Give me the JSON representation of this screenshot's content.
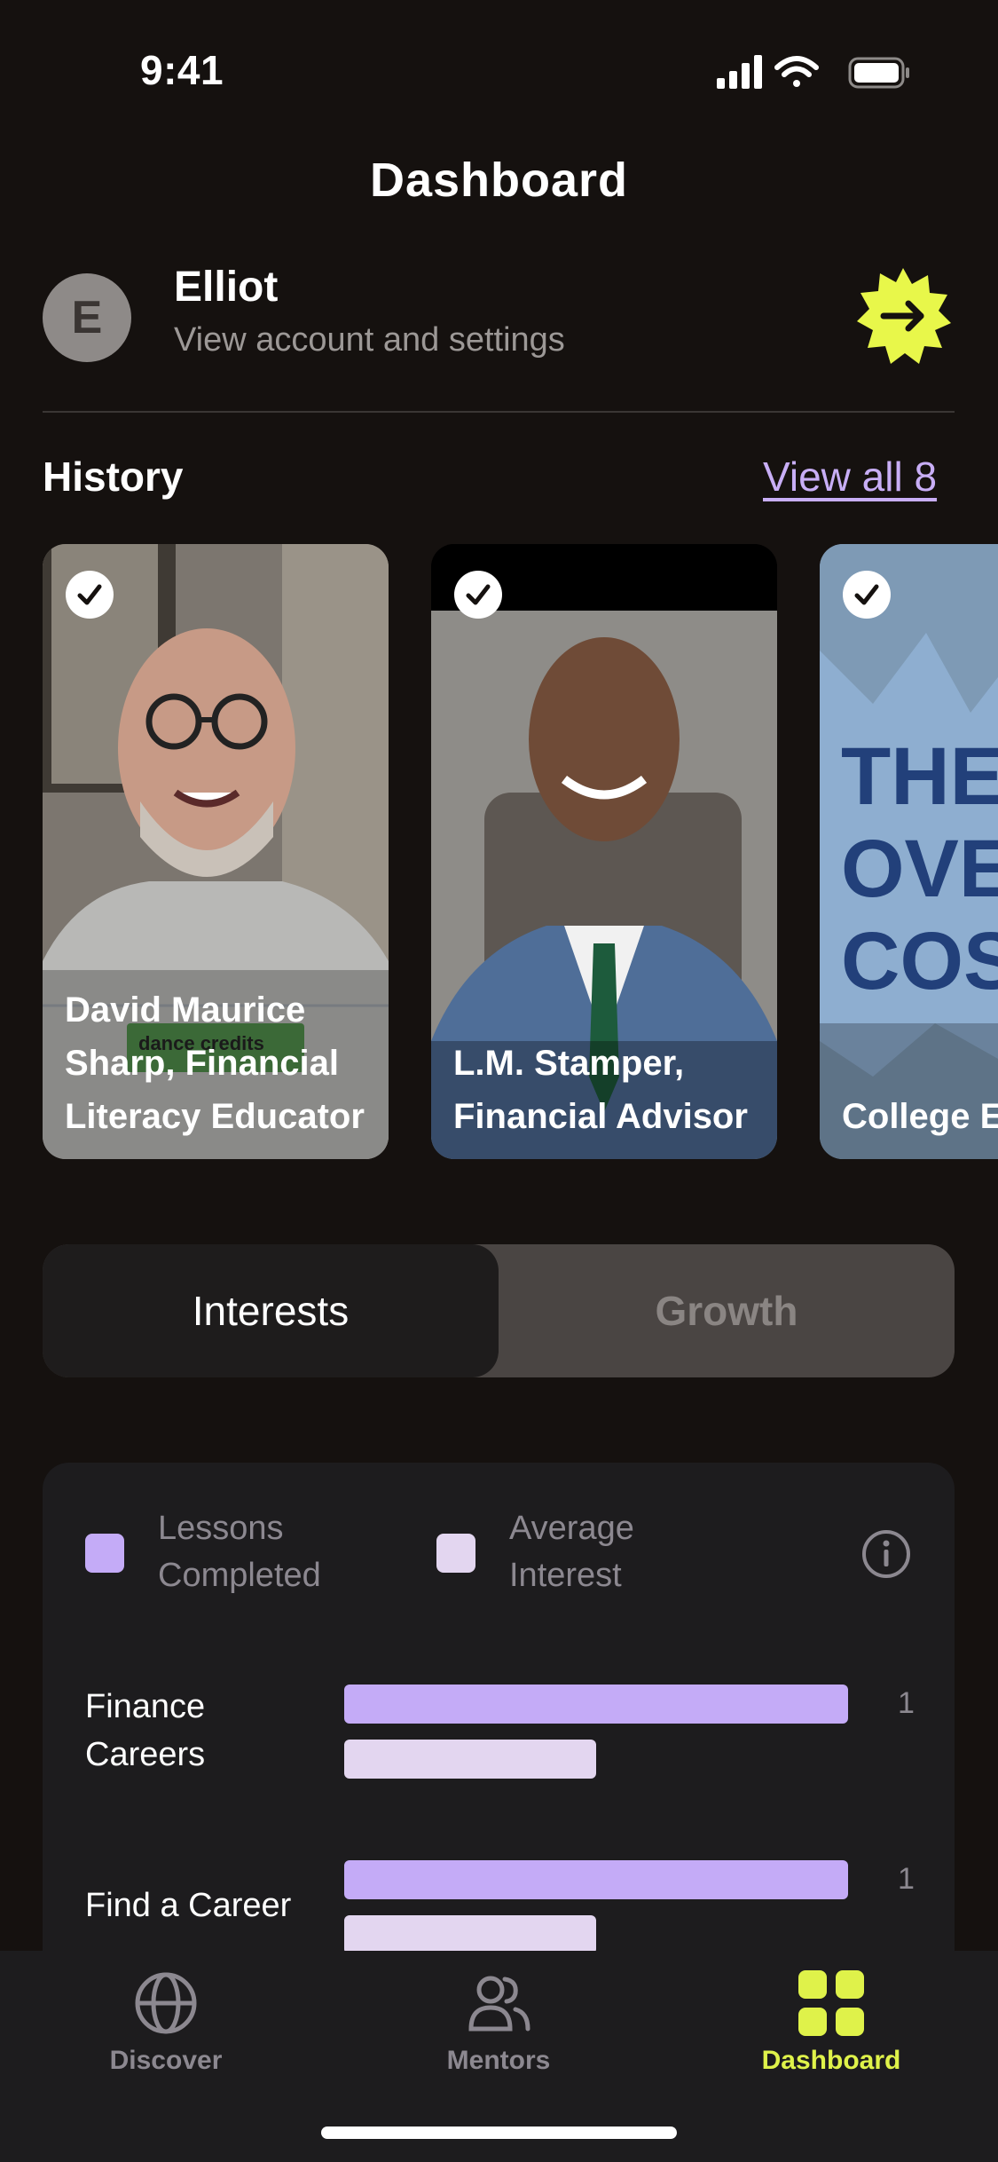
{
  "status": {
    "time": "9:41"
  },
  "title": "Dashboard",
  "account": {
    "initial": "E",
    "name": "Elliot",
    "subtitle": "View account and settings"
  },
  "history": {
    "title": "History",
    "view_all": "View all 8",
    "cards": [
      {
        "lines": [
          "David Maurice",
          "Sharp, Financial",
          "Literacy Educator"
        ],
        "watermark": "dance credits"
      },
      {
        "lines": [
          "L.M. Stamper,",
          "Financial Advisor"
        ]
      },
      {
        "lines": [
          "College Ex"
        ],
        "poster_text": [
          "THE",
          "OVEI",
          "COST"
        ]
      }
    ]
  },
  "tabs": {
    "active": "Interests",
    "inactive": "Growth"
  },
  "chart_data": {
    "type": "bar",
    "legend": [
      {
        "label_lines": [
          "Lessons",
          "Completed"
        ],
        "color": "#c4abf7"
      },
      {
        "label_lines": [
          "Average",
          "Interest"
        ],
        "color": "#e3d6f0"
      }
    ],
    "categories": [
      {
        "label_lines": [
          "Finance",
          "Careers"
        ],
        "lessons_completed": 1,
        "average_interest": 0.5,
        "value_label": "1"
      },
      {
        "label_lines": [
          "Find a Career"
        ],
        "lessons_completed": 1,
        "average_interest": 0.5,
        "value_label": "1"
      }
    ],
    "xlim": [
      0,
      1
    ]
  },
  "nav": {
    "items": [
      {
        "label": "Discover",
        "icon": "globe-icon",
        "active": false
      },
      {
        "label": "Mentors",
        "icon": "people-icon",
        "active": false
      },
      {
        "label": "Dashboard",
        "icon": "grid-icon",
        "active": true
      }
    ],
    "active_color": "#dff24a",
    "inactive_color": "#8c8890"
  },
  "colors": {
    "background": "#15110f",
    "accent_link": "#c8aef6",
    "account_button": "#e8f74a"
  }
}
